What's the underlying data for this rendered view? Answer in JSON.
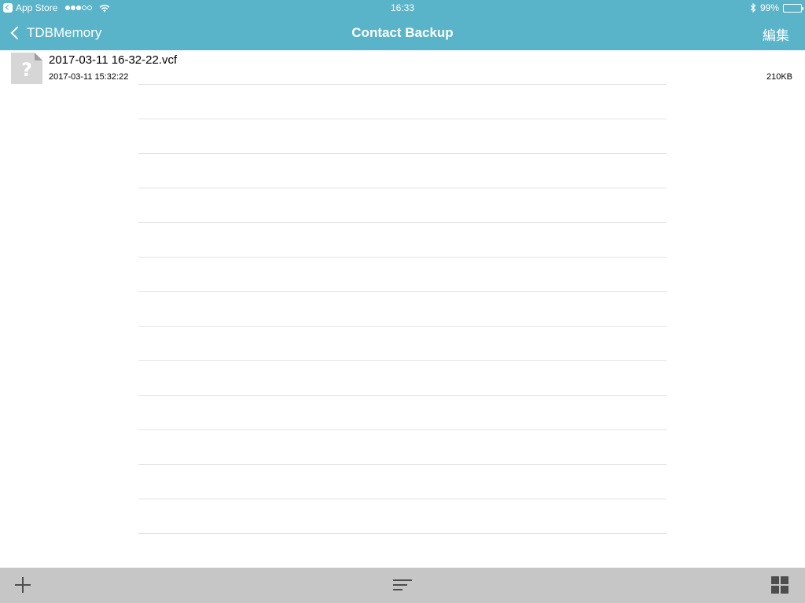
{
  "status_bar": {
    "back_app": "App Store",
    "time": "16:33",
    "battery": "99%",
    "battery_level": 0.99,
    "signal_bars_filled": 3,
    "signal_bars_total": 5
  },
  "nav": {
    "back_label": "TDBMemory",
    "title": "Contact Backup",
    "edit_label": "編集"
  },
  "files": [
    {
      "name": "2017-03-11 16-32-22.vcf",
      "date": "2017-03-11 15:32:22",
      "size": "210KB",
      "icon": "unknown-file-icon"
    }
  ],
  "toolbar": {
    "icons": [
      "add-icon",
      "sort-icon",
      "grid-view-icon"
    ]
  },
  "colors": {
    "header": "#59b3c9",
    "toolbar": "#c6c6c6",
    "toolbar_icon": "#4d4d4d",
    "separator": "#e3e3e3"
  }
}
